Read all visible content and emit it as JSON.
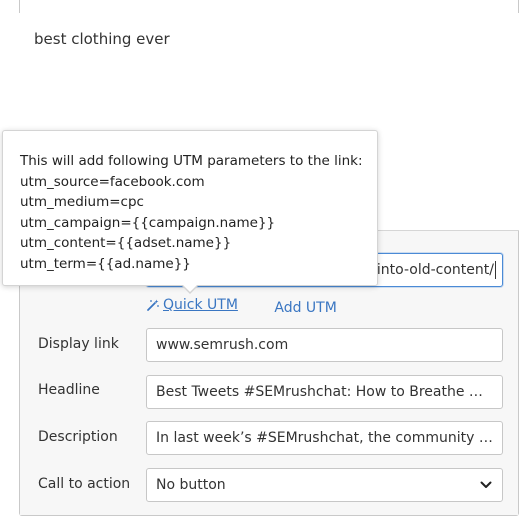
{
  "ad_text": {
    "value": "best clothing ever"
  },
  "link": {
    "visible_value": "into-old-content/"
  },
  "utm": {
    "quick_label": "Quick UTM",
    "add_label": "Add UTM",
    "quick_icon": "magic-wand-icon"
  },
  "tooltip": {
    "heading": "This will add following UTM parameters to the link:",
    "params": [
      "utm_source=facebook.com",
      "utm_medium=cpc",
      "utm_campaign={{campaign.name}}",
      "utm_content={{adset.name}}",
      "utm_term={{ad.name}}"
    ]
  },
  "form": {
    "display_link": {
      "label": "Display link",
      "value": "www.semrush.com"
    },
    "headline": {
      "label": "Headline",
      "value": "Best Tweets #SEMrushchat: How to Breathe New Life into Old Content"
    },
    "description": {
      "label": "Description",
      "value": "In last week’s #SEMrushchat, the community and our guests discussed"
    },
    "call_to_action": {
      "label": "Call to action",
      "value": "No button",
      "icon": "chevron-down-icon"
    }
  },
  "colors": {
    "link_blue": "#3a76c2",
    "focus_border": "#4a8ad6",
    "field_border": "#c7c7c7",
    "band_bg": "#f7f7f7"
  }
}
